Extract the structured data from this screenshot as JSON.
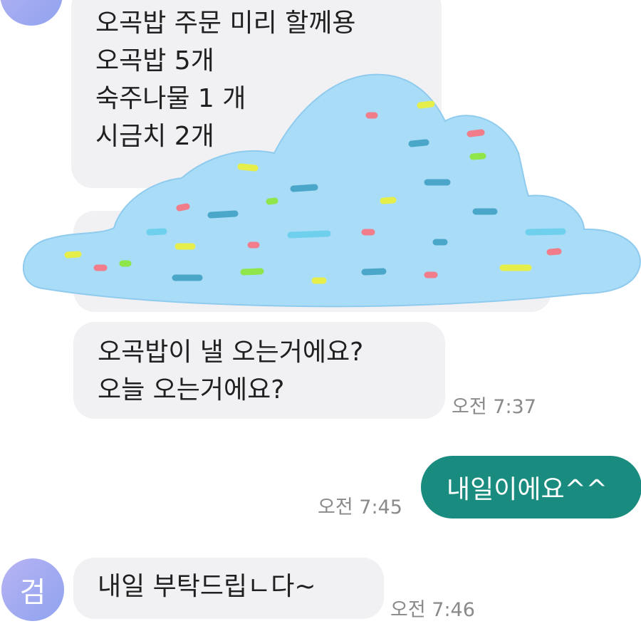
{
  "messages": [
    {
      "sender": "other",
      "lines": [
        "오곡밥 주문 미리 할께용",
        "오곡밥 5개",
        "숙주나물 1 개",
        "시금치 2개"
      ]
    },
    {
      "sender": "other",
      "lines": [
        "오곡밥이 낼 오는거에요?",
        "오늘 오는거에요?"
      ],
      "time": "오전 7:37"
    },
    {
      "sender": "me",
      "lines": [
        "내일이에요^^"
      ],
      "time": "오전 7:45"
    },
    {
      "sender": "other",
      "lines": [
        "내일 부탁드립ㄴ다~"
      ],
      "time": "오전 7:46"
    }
  ],
  "avatar": {
    "initial": "검"
  },
  "colors": {
    "incoming_bubble": "#f1f1f3",
    "outgoing_bubble": "#1a8b7f",
    "cloud": "#a9dcf7",
    "avatar": "#a3aaf0"
  },
  "icons": {
    "censor_overlay": "cloud-sticker-icon"
  }
}
